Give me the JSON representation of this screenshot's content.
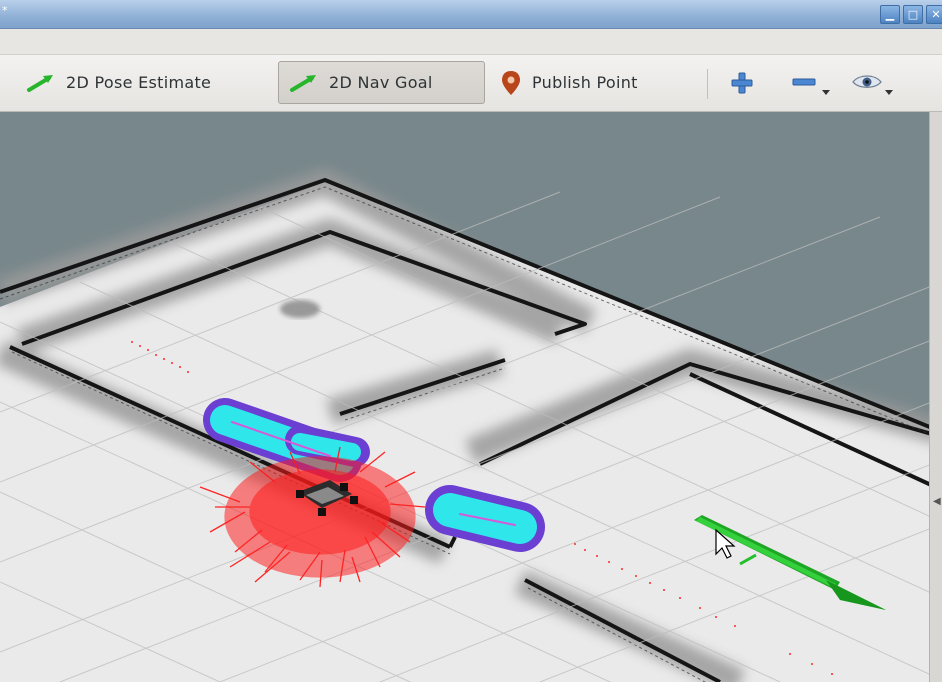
{
  "window": {
    "title": "*"
  },
  "toolbar": {
    "tools": [
      {
        "label": "2D Pose Estimate",
        "icon": "green-arrow-icon"
      },
      {
        "label": "2D Nav Goal",
        "icon": "green-arrow-icon",
        "active": true
      },
      {
        "label": "Publish Point",
        "icon": "map-pin-icon"
      }
    ],
    "view_buttons": [
      "plus-icon",
      "minus-icon",
      "eye-icon"
    ]
  },
  "viewport": {
    "scene": "3D map view with robot, particle cloud, costmap and navigation goal arrow"
  },
  "colors": {
    "accent": "#22c02a",
    "particles": "#ff1a1a",
    "costmap_inner": "#2fe6ea",
    "costmap_outer": "#6a3fd1",
    "background": "#78878b"
  }
}
